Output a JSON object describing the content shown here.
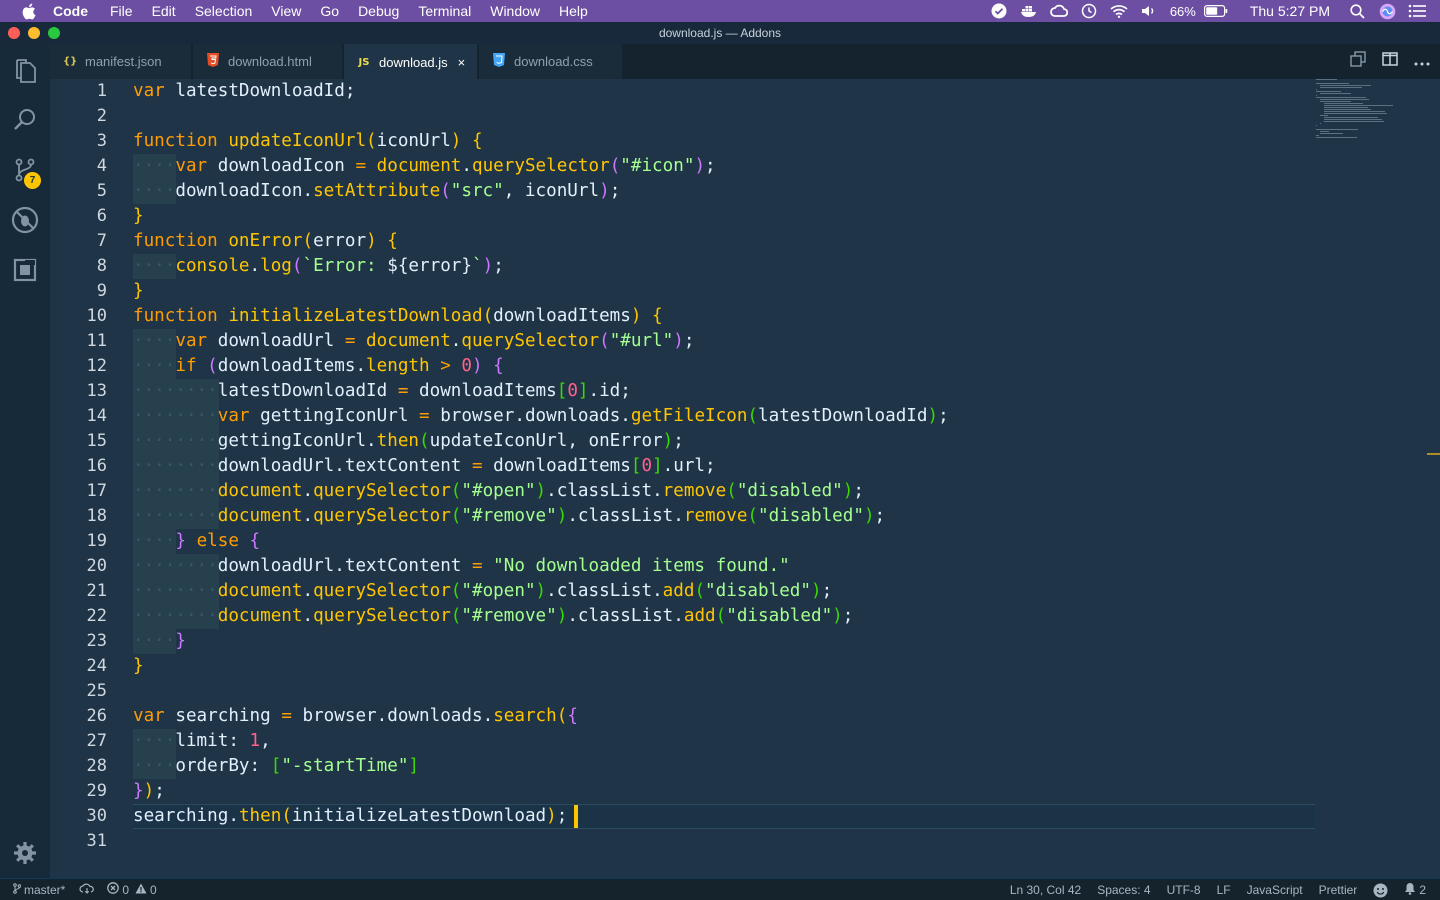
{
  "menubar": {
    "app": "Code",
    "items": [
      "File",
      "Edit",
      "Selection",
      "View",
      "Go",
      "Debug",
      "Terminal",
      "Window",
      "Help"
    ],
    "battery": "66%",
    "clock": "Thu 5:27 PM"
  },
  "window": {
    "title": "download.js — Addons"
  },
  "activity": {
    "scm_badge": "7"
  },
  "tabs": [
    {
      "label": "manifest.json",
      "icon": "{}"
    },
    {
      "label": "download.html",
      "icon": "5"
    },
    {
      "label": "download.js",
      "icon": "JS",
      "active": true,
      "close": "×"
    },
    {
      "label": "download.css",
      "icon": "3"
    }
  ],
  "editor": {
    "line_numbers": [
      "1",
      "2",
      "3",
      "4",
      "5",
      "6",
      "7",
      "8",
      "9",
      "10",
      "11",
      "12",
      "13",
      "14",
      "15",
      "16",
      "17",
      "18",
      "19",
      "20",
      "21",
      "22",
      "23",
      "24",
      "25",
      "26",
      "27",
      "28",
      "29",
      "30",
      "31"
    ]
  },
  "statusbar": {
    "branch": "master*",
    "errors": "0",
    "warnings": "0",
    "position": "Ln 30, Col 42",
    "spaces": "Spaces: 4",
    "encoding": "UTF-8",
    "eol": "LF",
    "language": "JavaScript",
    "formatter": "Prettier",
    "notifications": "2"
  }
}
